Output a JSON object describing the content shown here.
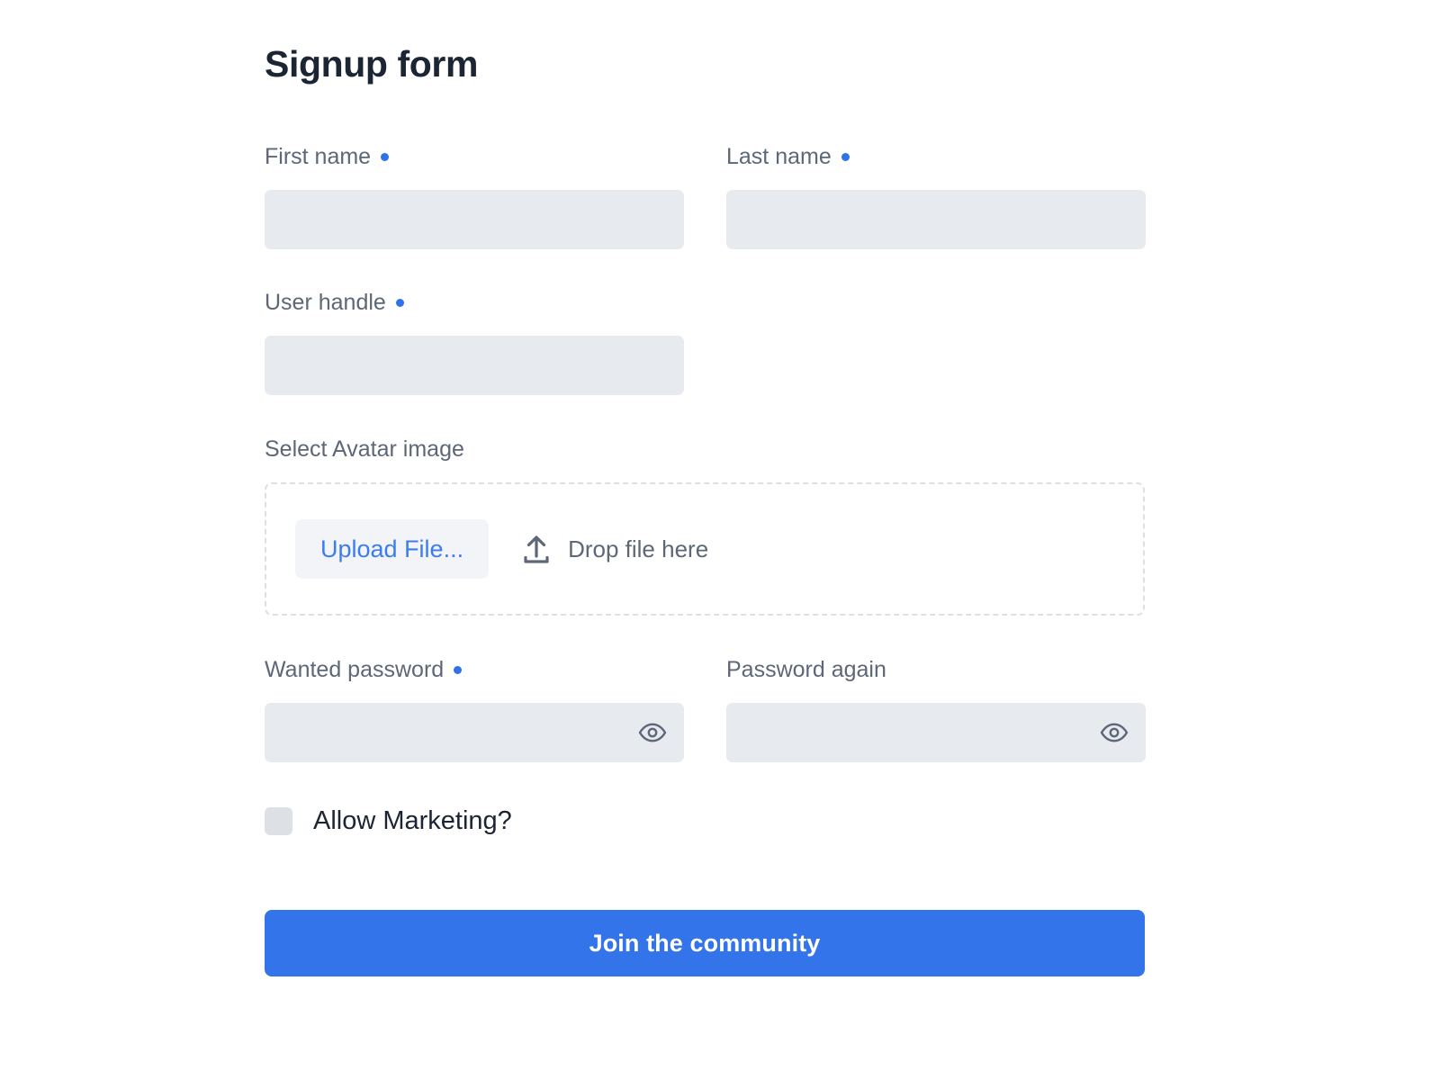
{
  "form": {
    "title": "Signup form",
    "fields": {
      "first_name": {
        "label": "First name",
        "value": "",
        "placeholder": ""
      },
      "last_name": {
        "label": "Last name",
        "value": "",
        "placeholder": ""
      },
      "user_handle": {
        "label": "User handle",
        "value": "",
        "placeholder": ""
      },
      "avatar": {
        "label": "Select Avatar image"
      },
      "wanted_password": {
        "label": "Wanted password",
        "value": "",
        "placeholder": ""
      },
      "password_again": {
        "label": "Password again",
        "value": "",
        "placeholder": ""
      }
    },
    "dropzone": {
      "upload_button_label": "Upload File...",
      "drop_hint": "Drop file here",
      "upload_icon": "upload-arrow-icon"
    },
    "marketing": {
      "label": "Allow Marketing?",
      "checked": false
    },
    "submit_label": "Join the community",
    "icons": {
      "reveal_password": "eye-icon"
    },
    "colors": {
      "accent": "#3374ea",
      "required_dot": "#2f72ea",
      "input_background": "#e7eaef",
      "label_text": "#5d6777",
      "title_text": "#1c2533",
      "dropzone_border": "#dcdfe4",
      "upload_button_background": "#f3f4f7",
      "upload_button_text": "#3b7cf0",
      "checkbox_background": "#dde0e5",
      "submit_text": "#ffffff"
    }
  }
}
